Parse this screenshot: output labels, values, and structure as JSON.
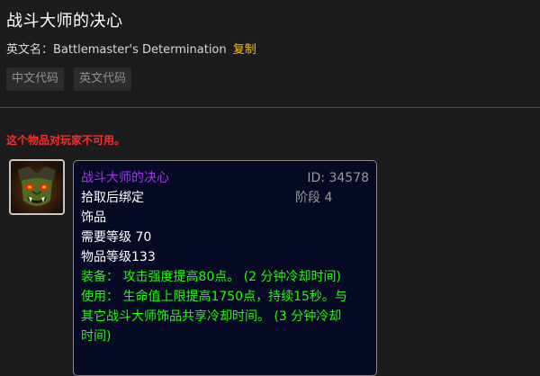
{
  "title": "战斗大师的决心",
  "english_name": {
    "label": "英文名：",
    "value": "Battlemaster's Determination",
    "copy_label": "复制"
  },
  "code_buttons": [
    {
      "label": "中文代码"
    },
    {
      "label": "英文代码"
    }
  ],
  "warning": "这个物品对玩家不可用。",
  "tooltip": {
    "name": "战斗大师的决心",
    "id": "ID: 34578",
    "stage": "阶段 4",
    "bind": "拾取后绑定",
    "slot": "饰品",
    "req_level": "需要等级 70",
    "item_level": "物品等级133",
    "equip_text": "装备： 攻击强度提高80点。 (2 分钟冷却时间)",
    "use_text": "使用： 生命值上限提高1750点，持续15秒。与其它战斗大师饰品共享冷却时间。 (3 分钟冷却时间)"
  },
  "icon": "orc-face-icon",
  "colors": {
    "background": "#1c1c1c",
    "copy_link": "#f2c200",
    "warning": "#ff2a2a",
    "epic_name": "#a335ee",
    "green_text": "#1eff00",
    "tooltip_bg": "#070a24"
  }
}
